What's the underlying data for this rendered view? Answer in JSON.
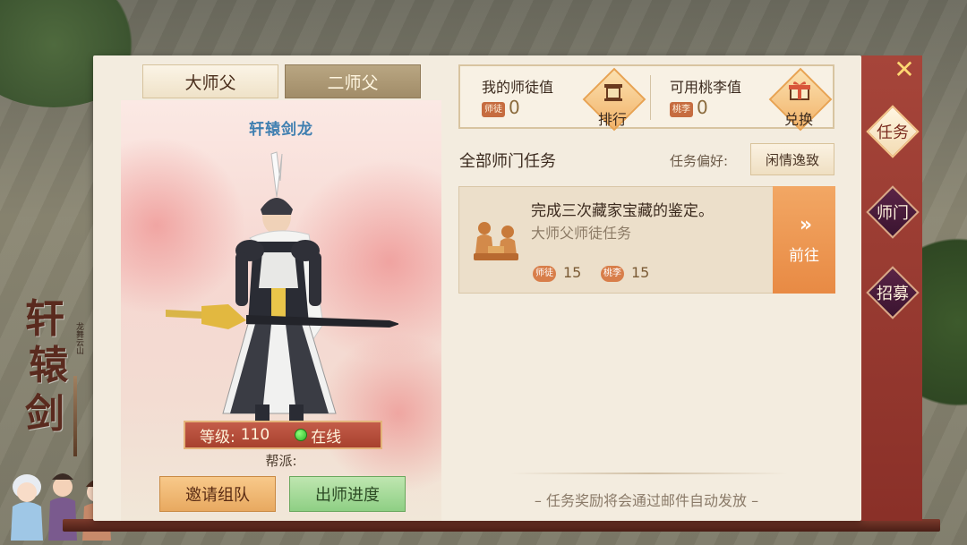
{
  "colors": {
    "panel_bg": "#f3ecdf",
    "sidebar_bg": "#8a3028",
    "accent_orange": "#e88a44",
    "tab_active": "#efe2c8",
    "tab_inactive": "#a18c68",
    "online_green": "#2fb12a",
    "character_name": "#3f7fb0"
  },
  "logo": {
    "chars": [
      "轩",
      "辕",
      "剑"
    ],
    "subtitle": "龙舞云山"
  },
  "tabs": [
    {
      "label": "大师父",
      "active": true
    },
    {
      "label": "二师父",
      "active": false
    }
  ],
  "character": {
    "name": "轩辕剑龙",
    "level_label": "等级:",
    "level_value": "110",
    "status": "在线",
    "guild_label": "帮派:"
  },
  "actions": {
    "invite": "邀请组队",
    "progress": "出师进度"
  },
  "stats": {
    "mentor_value": {
      "label": "我的师徒值",
      "badge": "师徒",
      "value": "0",
      "button": "排行",
      "icon": "lantern-icon"
    },
    "peach_value": {
      "label": "可用桃李值",
      "badge": "桃李",
      "value": "0",
      "button": "兑换",
      "icon": "gift-icon"
    }
  },
  "tasks": {
    "title": "全部师门任务",
    "preference_label": "任务偏好:",
    "preference_value": "闲情逸致",
    "items": [
      {
        "title": "完成三次藏家宝藏的鉴定。",
        "subtitle": "大师父师徒任务",
        "rewards": [
          {
            "badge": "师徒",
            "value": "15"
          },
          {
            "badge": "桃李",
            "value": "15"
          }
        ],
        "go_label": "前往",
        "icon": "appraisal-icon"
      }
    ],
    "footer_note": "– 任务奖励将会通过邮件自动发放 –"
  },
  "sidebar": {
    "close_icon": "close-icon",
    "items": [
      {
        "label": "任务",
        "active": true
      },
      {
        "label": "师门",
        "active": false
      },
      {
        "label": "招募",
        "active": false
      }
    ]
  }
}
